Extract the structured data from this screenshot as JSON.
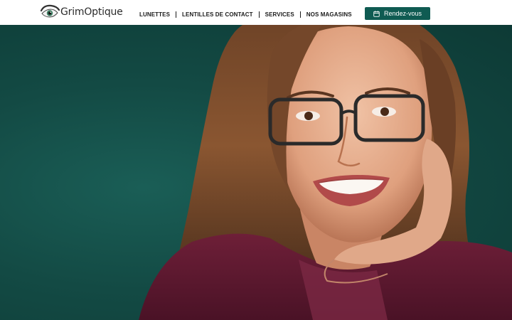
{
  "brand": {
    "name": "GrimOptique",
    "logo_icon": "eye-icon"
  },
  "nav": {
    "items": [
      {
        "label": "LUNETTES"
      },
      {
        "label": "LENTILLES DE CONTACT"
      },
      {
        "label": "SERVICES"
      },
      {
        "label": "NOS MAGASINS"
      }
    ]
  },
  "cta": {
    "label": "Rendez-vous",
    "icon": "calendar-icon"
  },
  "hero": {
    "image": "smiling-woman-with-glasses-photo"
  },
  "colors": {
    "accent": "#0f5b52",
    "hero_background": "#134a44",
    "nav_text": "#1a1a1a"
  }
}
